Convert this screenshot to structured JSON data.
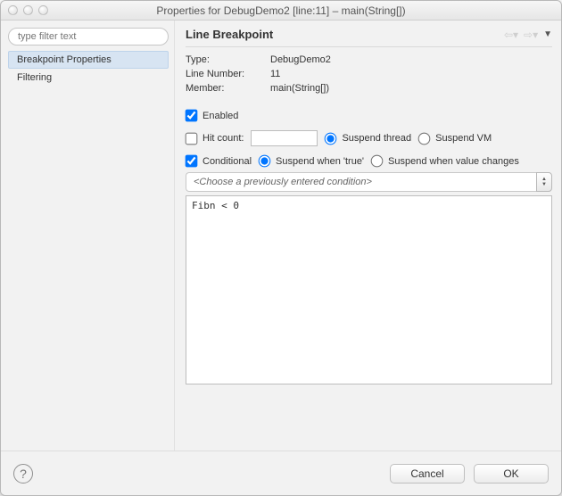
{
  "window": {
    "title": "Properties for DebugDemo2 [line:11] – main(String[])"
  },
  "sidebar": {
    "filter_placeholder": "type filter text",
    "items": [
      {
        "label": "Breakpoint Properties",
        "selected": true
      },
      {
        "label": "Filtering",
        "selected": false
      }
    ]
  },
  "panel": {
    "heading": "Line Breakpoint",
    "fields": {
      "type_label": "Type:",
      "type_value": "DebugDemo2",
      "line_label": "Line Number:",
      "line_value": "11",
      "member_label": "Member:",
      "member_value": "main(String[])"
    },
    "enabled_label": "Enabled",
    "enabled_checked": true,
    "hitcount_label": "Hit count:",
    "hitcount_checked": false,
    "hitcount_value": "",
    "suspend_thread_label": "Suspend thread",
    "suspend_thread_selected": true,
    "suspend_vm_label": "Suspend VM",
    "suspend_vm_selected": false,
    "conditional_label": "Conditional",
    "conditional_checked": true,
    "suspend_true_label": "Suspend when 'true'",
    "suspend_true_selected": true,
    "suspend_change_label": "Suspend when value changes",
    "suspend_change_selected": false,
    "condition_dropdown_placeholder": "<Choose a previously entered condition>",
    "condition_text": "Fibn < 0"
  },
  "footer": {
    "help_tooltip": "?",
    "cancel": "Cancel",
    "ok": "OK"
  }
}
